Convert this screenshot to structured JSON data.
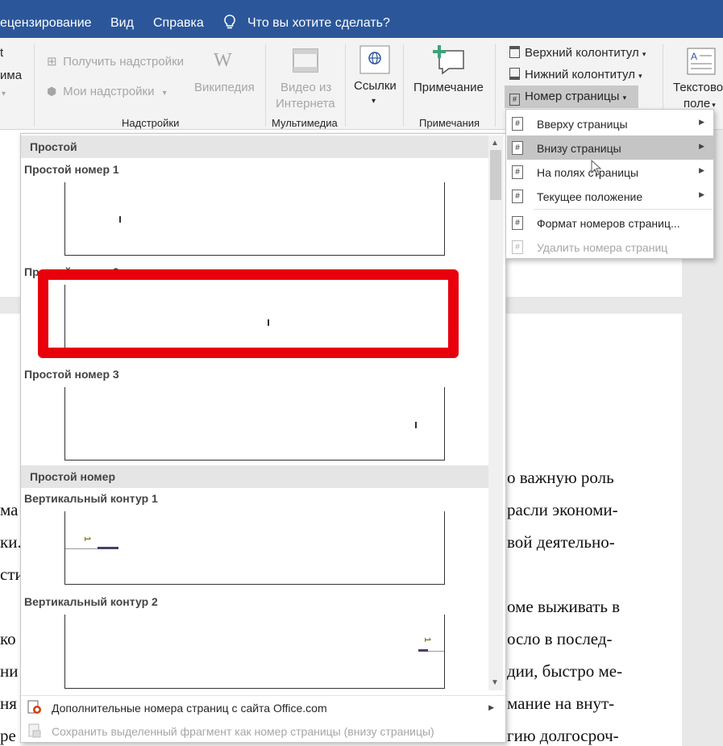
{
  "titlebar": {
    "tabs": [
      "ецензирование",
      "Вид",
      "Справка"
    ],
    "tell_me": "Что вы хотите сделать?"
  },
  "ribbon": {
    "left_cut": [
      "t",
      "има"
    ],
    "get_addins": "Получить надстройки",
    "my_addins": "Мои надстройки",
    "wikipedia": "Википедия",
    "wiki_glyph": "W",
    "video_line1": "Видео из",
    "video_line2": "Интернета",
    "links": "Ссылки",
    "comment": "Примечание",
    "header": "Верхний колонтитул",
    "footer": "Нижний колонтитул",
    "page_number": "Номер страницы",
    "textbox_line1": "Текстово",
    "textbox_line2": "поле",
    "groups": {
      "addins": "Надстройки",
      "media": "Мультимедиа",
      "comments": "Примечания"
    }
  },
  "submenu": {
    "items": [
      {
        "label": "Вверху страницы",
        "arrow": "▶"
      },
      {
        "label": "Внизу страницы",
        "arrow": "▶"
      },
      {
        "label": "На полях страницы",
        "arrow": "▶"
      },
      {
        "label": "Текущее положение",
        "arrow": "▶"
      },
      {
        "label": "Формат номеров страниц..."
      },
      {
        "label": "Удалить номера страниц"
      }
    ]
  },
  "gallery": {
    "section1": "Простой",
    "items": [
      "Простой номер 1",
      "Простой номер 2",
      "Простой номер 3"
    ],
    "section2": "Простой номер",
    "items2": [
      "Вертикальный контур 1",
      "Вертикальный контур 2"
    ],
    "contour_glyph": "1",
    "more": "Дополнительные номера страниц с сайта Office.com",
    "save": "Сохранить выделенный фрагмент как номер страницы (внизу страницы)"
  },
  "document": {
    "right_fragments": [
      "о важную роль",
      "расли экономи-",
      "вой деятельно-",
      "оме выживать в",
      "осло в послед-",
      "дии, быстро ме-",
      "мание на внут-",
      "гию долгосроч-"
    ],
    "left_fragments": [
      "ма",
      "ки.",
      "сти",
      "ко",
      "ни",
      "ня",
      "ре"
    ]
  },
  "colors": {
    "titlebar": "#2b579a",
    "highlight_box": "#e8000c",
    "contour_accent": "#8c7a2e",
    "contour_bar": "#4a3f6b"
  }
}
